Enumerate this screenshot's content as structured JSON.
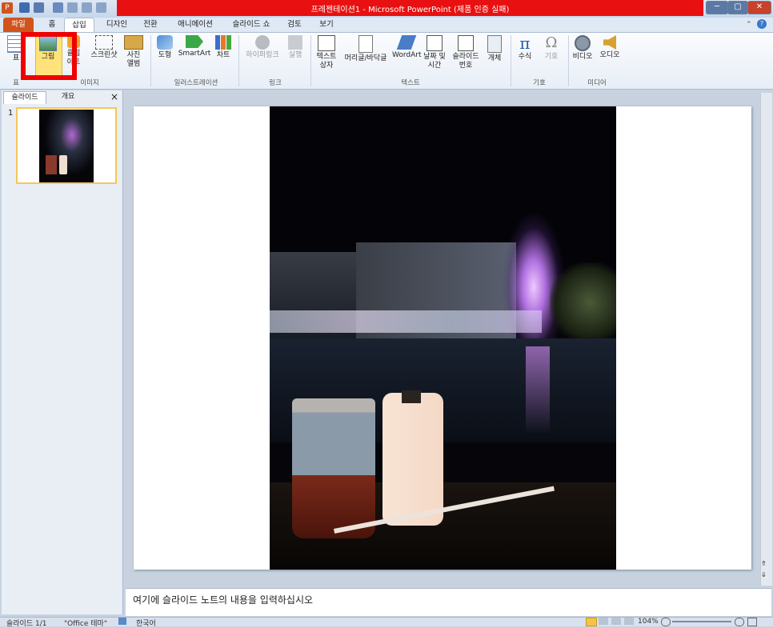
{
  "window": {
    "title": "프레젠테이션1 - Microsoft PowerPoint (제품 인증 실패)",
    "controls": [
      "─",
      "▢",
      "✕"
    ]
  },
  "tabs": [
    "파일",
    "홈",
    "삽입",
    "디자인",
    "전환",
    "애니메이션",
    "슬라이드 쇼",
    "검토",
    "보기"
  ],
  "ribbon": {
    "buttons": {
      "table": "표",
      "picture": "그림",
      "clipart_a": "클립",
      "clipart_b": "아트",
      "screenshot": "스크린샷",
      "album_a": "사진",
      "album_b": "앨범",
      "shapes": "도형",
      "smartart": "SmartArt",
      "chart": "차트",
      "hyperlink": "하이퍼링크",
      "action": "실행",
      "textbox_a": "텍스트",
      "textbox_b": "상자",
      "header_footer": "머리글/바닥글",
      "wordart": "WordArt",
      "datetime_a": "날짜 및",
      "datetime_b": "시간",
      "slidenum_a": "슬라이드",
      "slidenum_b": "번호",
      "object": "개체",
      "equation": "수식",
      "symbol": "기호",
      "video": "비디오",
      "audio": "오디오"
    },
    "groups": {
      "tables": "표",
      "images": "이미지",
      "illustrations": "일러스트레이션",
      "links": "링크",
      "text": "텍스트",
      "symbols": "기호",
      "media": "미디어"
    }
  },
  "left_panel": {
    "tab_slides": "슬라이드",
    "tab_outline": "개요",
    "close": "×",
    "slide_number": "1"
  },
  "notes": {
    "placeholder": "여기에 슬라이드 노트의 내용을 입력하십시오"
  },
  "status": {
    "slide": "슬라이드 1/1",
    "theme": "\"Office 테마\"",
    "language": "한국어",
    "zoom": "104%"
  },
  "colors": {
    "file_tab": "#d0541c",
    "title_highlight": "#e81010",
    "annotation_box": "#f00000"
  }
}
